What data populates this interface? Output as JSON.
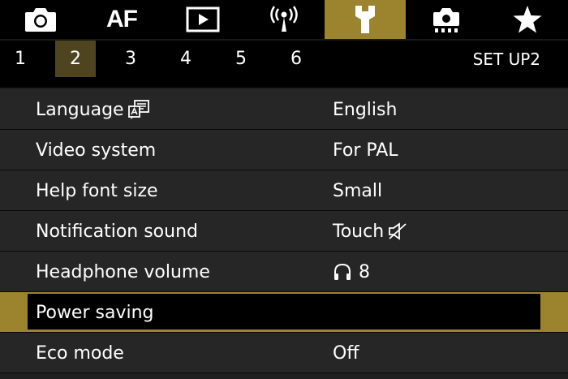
{
  "tabs": [
    {
      "icon": "camera-icon"
    },
    {
      "icon": "af-icon",
      "label": "AF"
    },
    {
      "icon": "playback-icon"
    },
    {
      "icon": "wireless-icon"
    },
    {
      "icon": "wrench-icon",
      "active": true
    },
    {
      "icon": "custom-function-icon"
    },
    {
      "icon": "star-icon"
    }
  ],
  "pages": [
    "1",
    "2",
    "3",
    "4",
    "5",
    "6"
  ],
  "active_page": "2",
  "page_title": "SET UP2",
  "menu": [
    {
      "label": "Language",
      "label_icon": "language-icon",
      "value": "English"
    },
    {
      "label": "Video system",
      "value": "For PAL"
    },
    {
      "label": "Help font size",
      "value": "Small"
    },
    {
      "label": "Notification sound",
      "value": "Touch",
      "value_icon": "speaker-muted-icon"
    },
    {
      "label": "Headphone volume",
      "value_icon": "headphone-icon",
      "value": "8"
    },
    {
      "label": "Power saving",
      "value": "",
      "selected": true
    },
    {
      "label": "Eco mode",
      "value": "Off"
    }
  ],
  "colors": {
    "accent": "#9c842f",
    "page_active": "#4e4520",
    "row_bg": "#262626"
  }
}
